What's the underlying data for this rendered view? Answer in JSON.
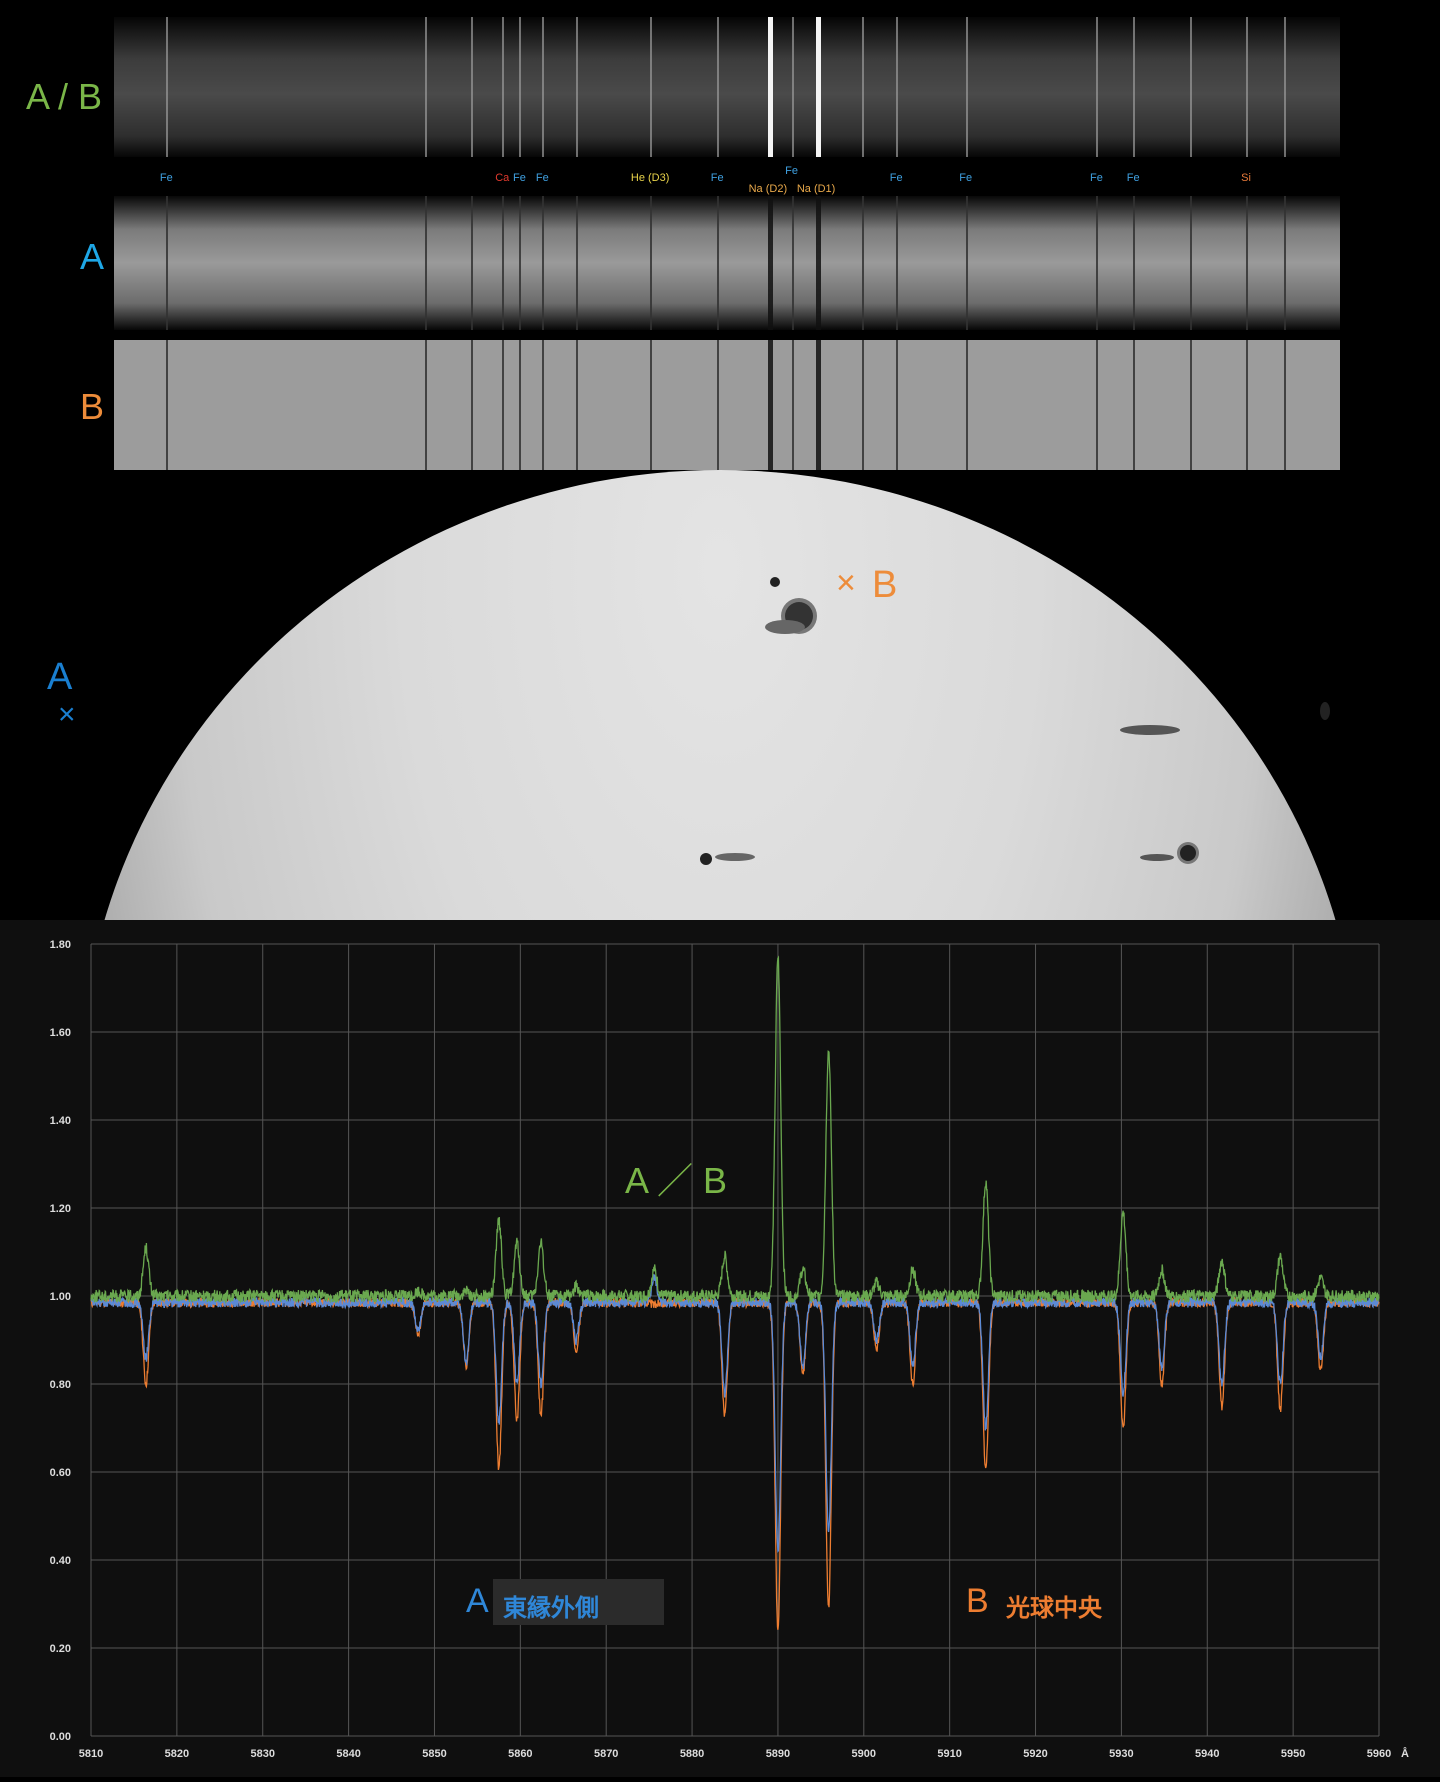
{
  "spectra": {
    "labels": {
      "ab": "A / B",
      "a": "A",
      "b": "B"
    },
    "label_colors": {
      "ab": "#7ab648",
      "a": "#1ea7e6",
      "b": "#ed8c3a"
    },
    "lines": [
      {
        "text": "Fe",
        "x": 5816.4,
        "color": "#3fa0e0"
      },
      {
        "text": "Ca",
        "x": 5857.5,
        "color": "#e03a2e"
      },
      {
        "text": "Fe",
        "x": 5859.6,
        "color": "#3fa0e0"
      },
      {
        "text": "Fe",
        "x": 5862.4,
        "color": "#3fa0e0"
      },
      {
        "text": "He (D3)",
        "x": 5875.6,
        "color": "#e8d24a"
      },
      {
        "text": "Fe",
        "x": 5883.8,
        "color": "#3fa0e0"
      },
      {
        "text": "Na (D2)",
        "x": 5890.0,
        "color": "#e8a84a"
      },
      {
        "text": "Fe",
        "x": 5892.9,
        "color": "#3fa0e0"
      },
      {
        "text": "Na (D1)",
        "x": 5895.9,
        "color": "#e8a84a"
      },
      {
        "text": "Fe",
        "x": 5905.7,
        "color": "#3fa0e0"
      },
      {
        "text": "Fe",
        "x": 5914.2,
        "color": "#3fa0e0"
      },
      {
        "text": "Fe",
        "x": 5930.2,
        "color": "#3fa0e0"
      },
      {
        "text": "Fe",
        "x": 5934.7,
        "color": "#3fa0e0"
      },
      {
        "text": "Si",
        "x": 5948.5,
        "color": "#e87a3a"
      }
    ]
  },
  "solar_disk": {
    "marker_a_label": "A",
    "marker_a_symbol": "×",
    "marker_b_symbol": "×",
    "marker_b_label": "B"
  },
  "chart_data": {
    "type": "line",
    "title": "",
    "xlabel": "",
    "x_unit": "Å",
    "ylabel": "",
    "xlim": [
      5810,
      5960
    ],
    "ylim": [
      0,
      1.8
    ],
    "x_ticks": [
      5810,
      5820,
      5830,
      5840,
      5850,
      5860,
      5870,
      5880,
      5890,
      5900,
      5910,
      5920,
      5930,
      5940,
      5950,
      5960
    ],
    "y_ticks": [
      "0.00",
      "0.20",
      "0.40",
      "0.60",
      "0.80",
      "1.00",
      "1.20",
      "1.40",
      "1.60",
      "1.80"
    ],
    "grid": true,
    "series": [
      {
        "name": "B",
        "color": "#ed7d31"
      },
      {
        "name": "A",
        "color": "#5b8ad6"
      },
      {
        "name": "A / B",
        "color": "#6aa84f"
      }
    ],
    "absorption_lines": [
      {
        "x": 5816.4,
        "a": 0.86,
        "b": 0.8,
        "ratio": 1.11
      },
      {
        "x": 5848.1,
        "a": 0.92,
        "b": 0.91,
        "ratio": 1.01
      },
      {
        "x": 5853.7,
        "a": 0.85,
        "b": 0.84,
        "ratio": 1.01
      },
      {
        "x": 5857.5,
        "a": 0.71,
        "b": 0.61,
        "ratio": 1.17
      },
      {
        "x": 5859.6,
        "a": 0.8,
        "b": 0.72,
        "ratio": 1.12
      },
      {
        "x": 5862.4,
        "a": 0.8,
        "b": 0.73,
        "ratio": 1.12
      },
      {
        "x": 5866.5,
        "a": 0.9,
        "b": 0.88,
        "ratio": 1.02
      },
      {
        "x": 5875.6,
        "a": 1.04,
        "b": 0.98,
        "ratio": 1.06
      },
      {
        "x": 5883.8,
        "a": 0.78,
        "b": 0.73,
        "ratio": 1.09
      },
      {
        "x": 5890.0,
        "a": 0.42,
        "b": 0.24,
        "ratio": 1.77
      },
      {
        "x": 5892.9,
        "a": 0.84,
        "b": 0.82,
        "ratio": 1.06
      },
      {
        "x": 5895.9,
        "a": 0.46,
        "b": 0.29,
        "ratio": 1.56
      },
      {
        "x": 5901.5,
        "a": 0.9,
        "b": 0.88,
        "ratio": 1.03
      },
      {
        "x": 5905.7,
        "a": 0.84,
        "b": 0.8,
        "ratio": 1.06
      },
      {
        "x": 5914.2,
        "a": 0.7,
        "b": 0.6,
        "ratio": 1.26
      },
      {
        "x": 5930.2,
        "a": 0.78,
        "b": 0.7,
        "ratio": 1.19
      },
      {
        "x": 5934.7,
        "a": 0.84,
        "b": 0.8,
        "ratio": 1.06
      },
      {
        "x": 5941.7,
        "a": 0.8,
        "b": 0.75,
        "ratio": 1.08
      },
      {
        "x": 5948.5,
        "a": 0.8,
        "b": 0.74,
        "ratio": 1.09
      },
      {
        "x": 5953.2,
        "a": 0.86,
        "b": 0.83,
        "ratio": 1.04
      }
    ],
    "annotations": {
      "ratio_label": "A ／ B",
      "a_letter": "A",
      "a_text": "東縁外側",
      "b_letter": "B",
      "b_text": "光球中央"
    }
  }
}
